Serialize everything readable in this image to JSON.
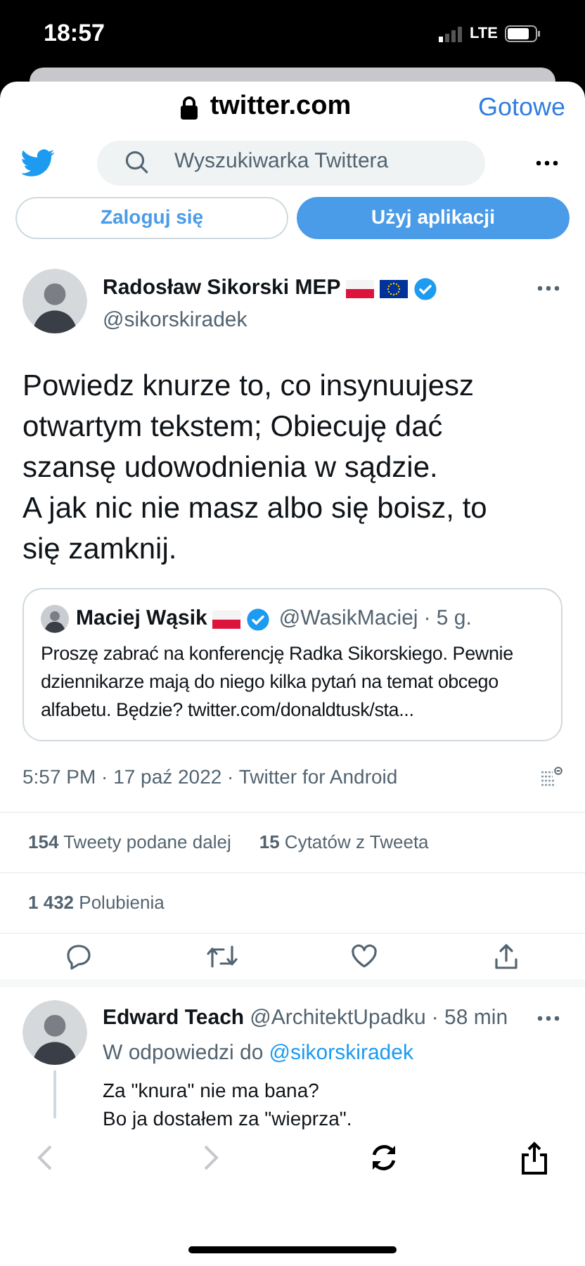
{
  "status_bar": {
    "time": "18:57",
    "network": "LTE"
  },
  "browser": {
    "domain": "twitter.com",
    "done": "Gotowe"
  },
  "header": {
    "search": {
      "placeholder": "Wyszukiwarka Twittera"
    }
  },
  "auth_buttons": [
    {
      "label": "Zaloguj się",
      "kind": "outline"
    },
    {
      "label": "Użyj aplikacji",
      "kind": "filled"
    }
  ],
  "tweet": {
    "name": "Radosław Sikorski MEP",
    "flags": [
      {
        "kind": "pl"
      },
      {
        "kind": "eu"
      }
    ],
    "verified": true,
    "handle": "@sikorskiradek",
    "text": [
      "Powiedz knurze to, co insynuujesz otwartym tekstem; Obiecuję dać szansę udowodnienia w sądzie.",
      "A jak nic nie masz albo się boisz, to się zamknij."
    ],
    "quote": {
      "name": "Maciej Wąsik",
      "flags": [
        {
          "kind": "pl"
        }
      ],
      "verified": true,
      "handle": "@WasikMaciej",
      "time": "· 5 g.",
      "text": "Proszę zabrać na konferencję Radka Sikorskiego.  Pewnie dziennikarze mają do niego kilka pytań na temat obcego alfabetu. Będzie? twitter.com/donaldtusk/sta..."
    },
    "meta": "5:57 PM · 17 paź 2022 · Twitter for Android",
    "stats": [
      "**154** Tweety podane dalej",
      "**15** Cytatów z Tweeta"
    ],
    "likes": "**1 432** Polubienia"
  },
  "reply": {
    "name": "Edward Teach",
    "handle": "@ArchitektUpadku",
    "time": "· 58 min",
    "reply_to_label": "W odpowiedzi do",
    "reply_to": "@sikorskiradek",
    "text": [
      "Za \"knura\" nie ma bana?",
      "Bo ja dostałem za \"wieprza\"."
    ]
  },
  "toolbar": {
    "back": {
      "disabled": true
    },
    "forward": {
      "disabled": true
    }
  }
}
